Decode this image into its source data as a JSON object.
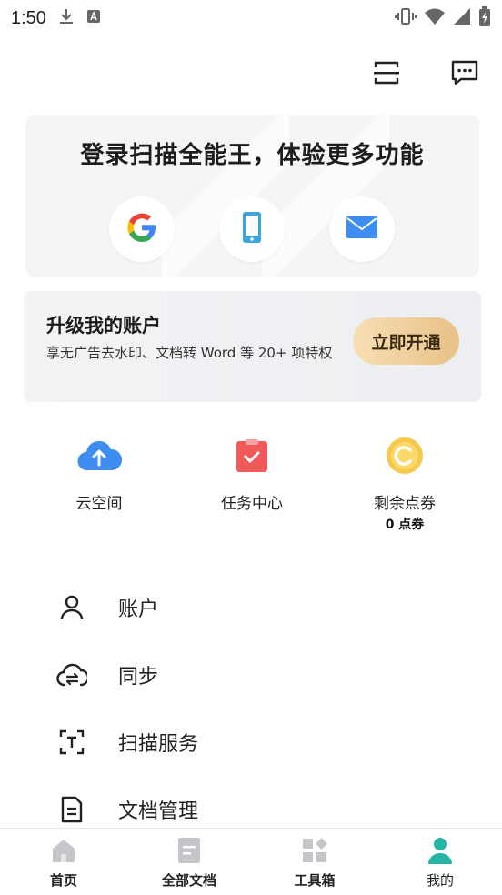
{
  "status_bar": {
    "time": "1:50",
    "left_icons": [
      "download-icon",
      "a-icon"
    ],
    "right_icons": [
      "vibrate-icon",
      "wifi-icon",
      "signal-icon",
      "battery-icon"
    ]
  },
  "top_bar": {
    "icons": [
      "scan-icon",
      "message-icon"
    ]
  },
  "login_card": {
    "title": "登录扫描全能王，体验更多功能",
    "methods": [
      "google-icon",
      "phone-icon",
      "mail-icon"
    ]
  },
  "upgrade_card": {
    "title": "升级我的账户",
    "desc": "享无广告去水印、文档转 Word 等 20+ 项特权",
    "button": "立即开通"
  },
  "quick_actions": [
    {
      "label": "云空间",
      "icon": "cloud-upload-icon"
    },
    {
      "label": "任务中心",
      "icon": "task-center-icon"
    },
    {
      "label": "剩余点券",
      "icon": "coupon-coin-icon",
      "sub": "0 点券"
    }
  ],
  "menu": [
    {
      "label": "账户",
      "icon": "user-icon"
    },
    {
      "label": "同步",
      "icon": "cloud-sync-icon"
    },
    {
      "label": "扫描服务",
      "icon": "scan-text-icon"
    },
    {
      "label": "文档管理",
      "icon": "document-icon"
    }
  ],
  "bottom_nav": [
    {
      "label": "首页",
      "icon": "home-icon"
    },
    {
      "label": "全部文档",
      "icon": "all-docs-icon"
    },
    {
      "label": "工具箱",
      "icon": "toolbox-icon"
    },
    {
      "label": "我的",
      "icon": "profile-icon",
      "active": true
    }
  ],
  "colors": {
    "accent_teal": "#26b5a5",
    "cloud_blue": "#3d8ef0",
    "task_red": "#f05a5a",
    "coin_yellow": "#f6c94a",
    "upgrade_gold": "#e8c187"
  }
}
